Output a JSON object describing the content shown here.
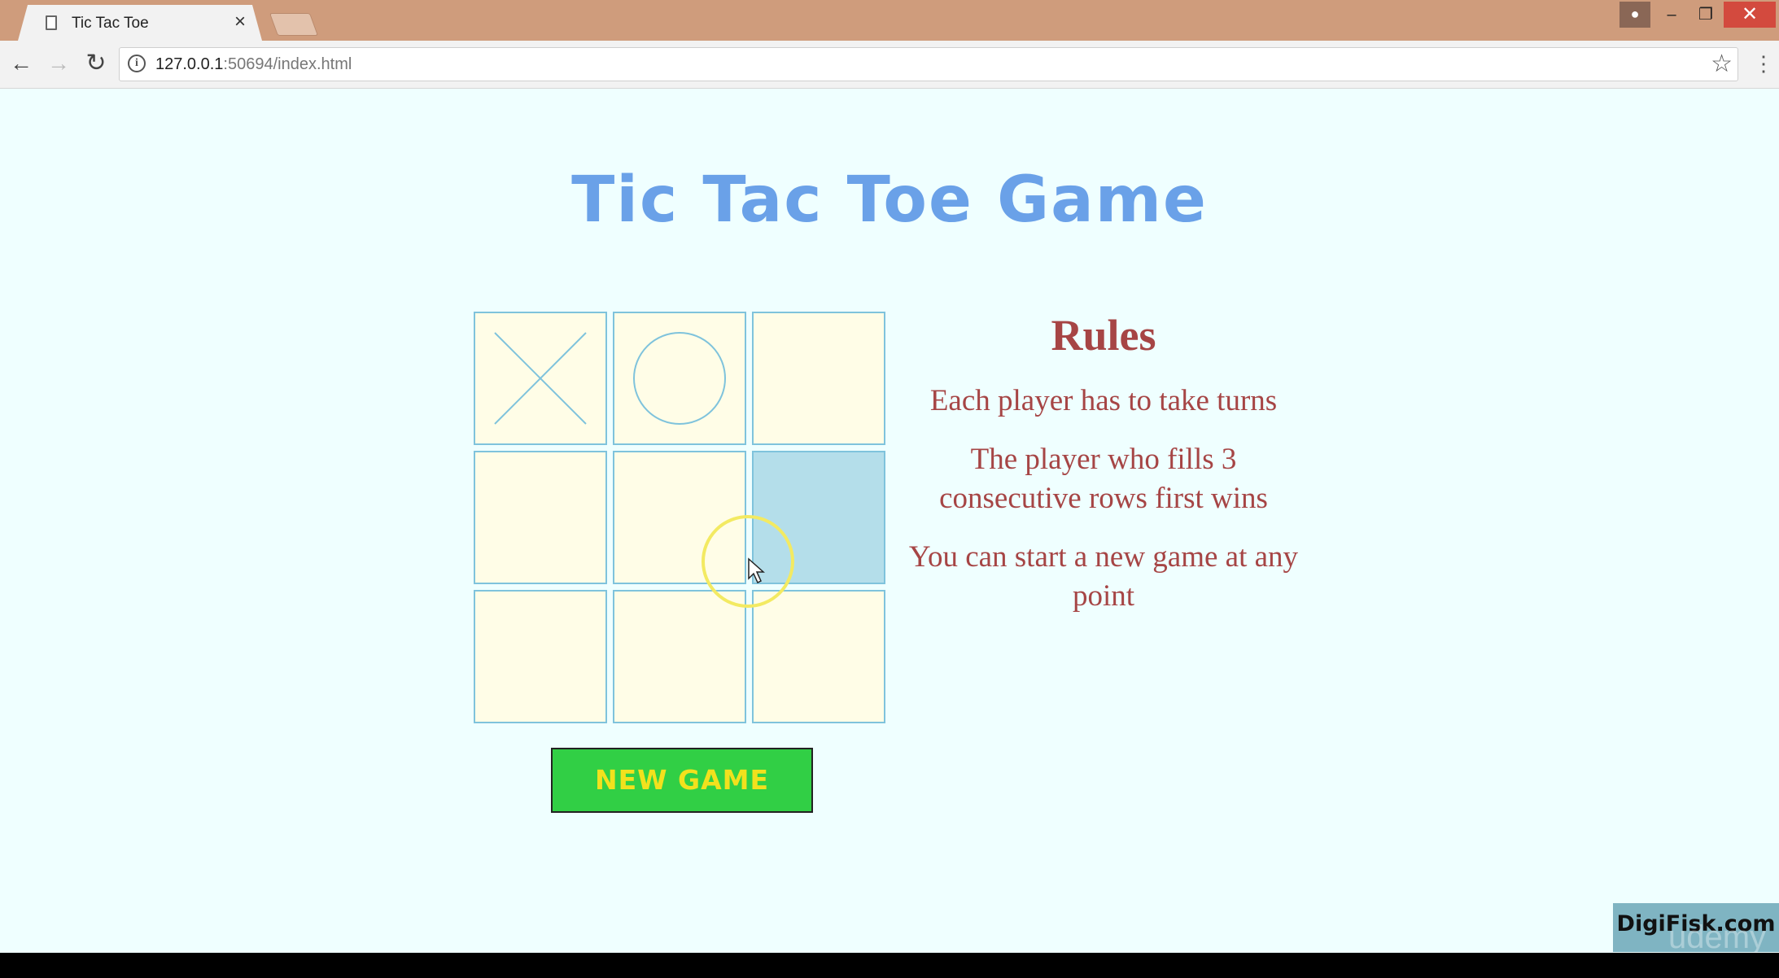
{
  "browser": {
    "tab_title": "Tic Tac Toe",
    "tab_close": "×",
    "url_host": "127.0.0.1",
    "url_path": ":50694/index.html",
    "back_icon": "←",
    "forward_icon": "→",
    "reload_icon": "↻",
    "star_icon": "☆",
    "menu_icon": "⋮",
    "minimize_icon": "–",
    "maximize_icon": "❐",
    "close_icon": "✕",
    "user_icon": "👤"
  },
  "game": {
    "title": "Tic Tac Toe Game",
    "board": [
      [
        "X",
        "O",
        ""
      ],
      [
        "",
        "",
        ""
      ],
      [
        "",
        "",
        ""
      ]
    ],
    "hovered_cell": "row 2, col 3",
    "new_game_label": "NEW GAME"
  },
  "rules": {
    "heading": "Rules",
    "items": [
      "Each player has to take turns",
      "The player who fills 3 consecutive rows first wins",
      "You can start a new game at any point"
    ]
  },
  "watermark": {
    "brand": "DigiFisk.com",
    "overlay": "udemy"
  },
  "colors": {
    "title": "#6aa1e8",
    "cell_bg": "#fffde7",
    "cell_hover": "#b4deea",
    "cell_border": "#7fc3dc",
    "button_bg": "#31cf45",
    "button_text": "#f2e11d",
    "rules_text": "#a64545",
    "page_bg": "#efffff"
  }
}
